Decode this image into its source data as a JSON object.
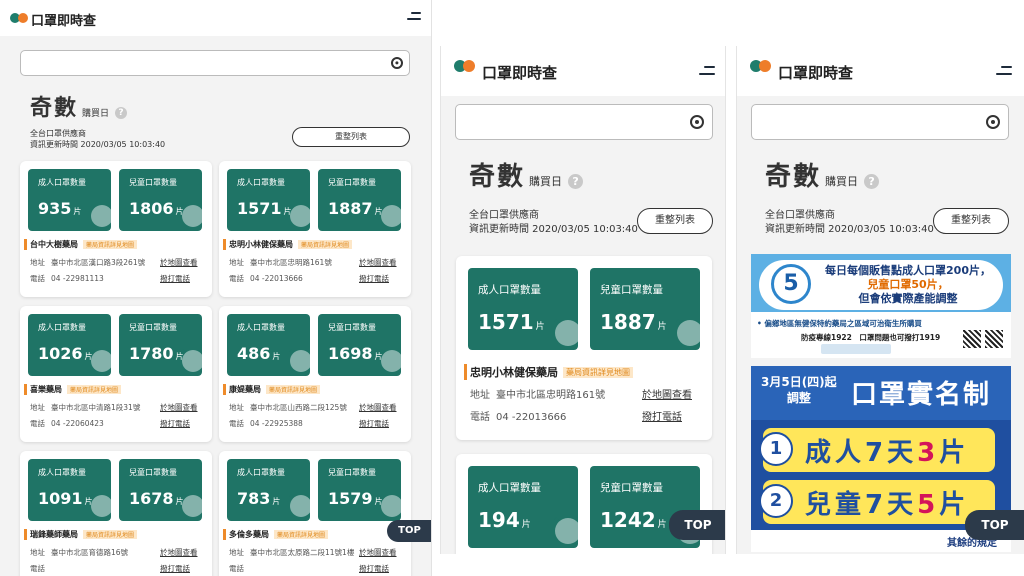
{
  "app": {
    "title": "口罩即時查"
  },
  "parity": {
    "value": "奇數",
    "label": "購買日",
    "help": "?"
  },
  "meta": {
    "supplier": "全台口罩供應商",
    "updated": "資訊更新時間 2020/03/05 10:03:40"
  },
  "reset_label": "重整列表",
  "labels": {
    "adult": "成人口罩數量",
    "child": "兒童口罩數量",
    "unit": "片",
    "note": "藥局資訊詳見地圖",
    "address": "地址",
    "phone": "電話",
    "map_link": "於地圖查看",
    "call_link": "撥打電話"
  },
  "pharmacies": [
    {
      "name": "台中大樹藥局",
      "adult": "935",
      "child": "1806",
      "address": "臺中市北區漢口路3段261號",
      "phone": "04 -22981113"
    },
    {
      "name": "忠明小林健保藥局",
      "adult": "1571",
      "child": "1887",
      "address": "臺中市北區忠明路161號",
      "phone": "04 -22013666"
    },
    {
      "name": "喜樂藥局",
      "adult": "1026",
      "child": "1780",
      "address": "臺中市北區中清路1段31號",
      "phone": "04 -22060423"
    },
    {
      "name": "康媞藥局",
      "adult": "486",
      "child": "1698",
      "address": "臺中市北區山西路二段125號",
      "phone": "04 -22925388"
    },
    {
      "name": "瑞鋒藥師藥局",
      "adult": "1091",
      "child": "1678",
      "address": "臺中市北區育德路16號",
      "phone": ""
    },
    {
      "name": "多倫多藥局",
      "adult": "783",
      "child": "1579",
      "address": "臺中市北區太原路二段11號1樓",
      "phone": ""
    }
  ],
  "second_screen_extra": {
    "adult": "194",
    "child": "1242"
  },
  "top_label": "TOP",
  "poster1": {
    "number": "5",
    "line1": "每日每個販售點成人口罩200片，",
    "line2": "兒童口罩50片，",
    "line3": "但會依實際產能調整",
    "note": "• 偏鄉地區無健保特約藥局之區域可治衛生所購買",
    "hotline": "防疫專線1922　口罩問題也可撥打1919"
  },
  "poster2": {
    "date": "3月5日(四)起",
    "adjust": "調整",
    "headline": "口罩實名制",
    "rule1_num": "1",
    "rule1_text": "成人7天",
    "rule1_count": "3",
    "rule1_unit": "片",
    "rule2_num": "2",
    "rule2_text": "兒童7天",
    "rule2_count": "5",
    "rule2_unit": "片",
    "footer": "其餘的規定"
  },
  "colors": {
    "tile": "#1f7466",
    "accent": "#ee7d2a",
    "brand_green": "#1f7d6c",
    "top_button": "#2c3a4a"
  }
}
